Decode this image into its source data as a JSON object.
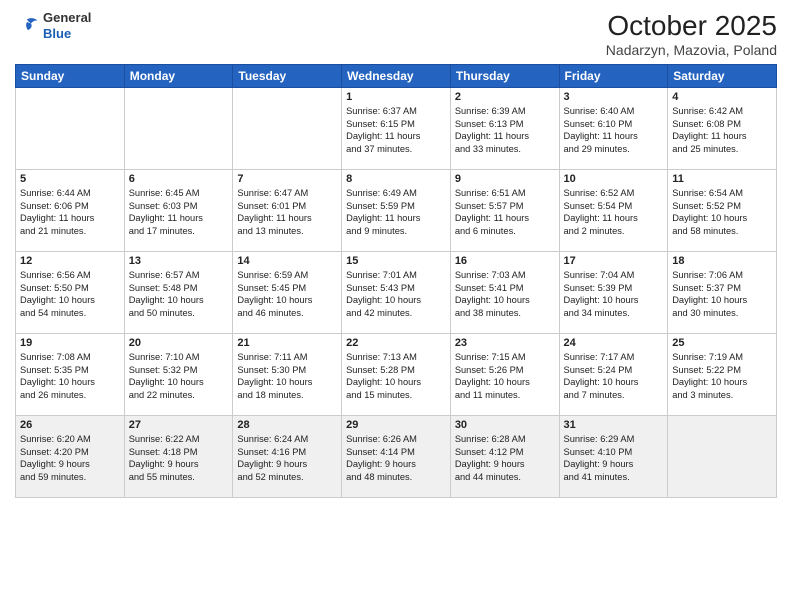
{
  "header": {
    "logo_general": "General",
    "logo_blue": "Blue",
    "month": "October 2025",
    "location": "Nadarzyn, Mazovia, Poland"
  },
  "days_of_week": [
    "Sunday",
    "Monday",
    "Tuesday",
    "Wednesday",
    "Thursday",
    "Friday",
    "Saturday"
  ],
  "weeks": [
    [
      {
        "day": "",
        "info": ""
      },
      {
        "day": "",
        "info": ""
      },
      {
        "day": "",
        "info": ""
      },
      {
        "day": "1",
        "info": "Sunrise: 6:37 AM\nSunset: 6:15 PM\nDaylight: 11 hours\nand 37 minutes."
      },
      {
        "day": "2",
        "info": "Sunrise: 6:39 AM\nSunset: 6:13 PM\nDaylight: 11 hours\nand 33 minutes."
      },
      {
        "day": "3",
        "info": "Sunrise: 6:40 AM\nSunset: 6:10 PM\nDaylight: 11 hours\nand 29 minutes."
      },
      {
        "day": "4",
        "info": "Sunrise: 6:42 AM\nSunset: 6:08 PM\nDaylight: 11 hours\nand 25 minutes."
      }
    ],
    [
      {
        "day": "5",
        "info": "Sunrise: 6:44 AM\nSunset: 6:06 PM\nDaylight: 11 hours\nand 21 minutes."
      },
      {
        "day": "6",
        "info": "Sunrise: 6:45 AM\nSunset: 6:03 PM\nDaylight: 11 hours\nand 17 minutes."
      },
      {
        "day": "7",
        "info": "Sunrise: 6:47 AM\nSunset: 6:01 PM\nDaylight: 11 hours\nand 13 minutes."
      },
      {
        "day": "8",
        "info": "Sunrise: 6:49 AM\nSunset: 5:59 PM\nDaylight: 11 hours\nand 9 minutes."
      },
      {
        "day": "9",
        "info": "Sunrise: 6:51 AM\nSunset: 5:57 PM\nDaylight: 11 hours\nand 6 minutes."
      },
      {
        "day": "10",
        "info": "Sunrise: 6:52 AM\nSunset: 5:54 PM\nDaylight: 11 hours\nand 2 minutes."
      },
      {
        "day": "11",
        "info": "Sunrise: 6:54 AM\nSunset: 5:52 PM\nDaylight: 10 hours\nand 58 minutes."
      }
    ],
    [
      {
        "day": "12",
        "info": "Sunrise: 6:56 AM\nSunset: 5:50 PM\nDaylight: 10 hours\nand 54 minutes."
      },
      {
        "day": "13",
        "info": "Sunrise: 6:57 AM\nSunset: 5:48 PM\nDaylight: 10 hours\nand 50 minutes."
      },
      {
        "day": "14",
        "info": "Sunrise: 6:59 AM\nSunset: 5:45 PM\nDaylight: 10 hours\nand 46 minutes."
      },
      {
        "day": "15",
        "info": "Sunrise: 7:01 AM\nSunset: 5:43 PM\nDaylight: 10 hours\nand 42 minutes."
      },
      {
        "day": "16",
        "info": "Sunrise: 7:03 AM\nSunset: 5:41 PM\nDaylight: 10 hours\nand 38 minutes."
      },
      {
        "day": "17",
        "info": "Sunrise: 7:04 AM\nSunset: 5:39 PM\nDaylight: 10 hours\nand 34 minutes."
      },
      {
        "day": "18",
        "info": "Sunrise: 7:06 AM\nSunset: 5:37 PM\nDaylight: 10 hours\nand 30 minutes."
      }
    ],
    [
      {
        "day": "19",
        "info": "Sunrise: 7:08 AM\nSunset: 5:35 PM\nDaylight: 10 hours\nand 26 minutes."
      },
      {
        "day": "20",
        "info": "Sunrise: 7:10 AM\nSunset: 5:32 PM\nDaylight: 10 hours\nand 22 minutes."
      },
      {
        "day": "21",
        "info": "Sunrise: 7:11 AM\nSunset: 5:30 PM\nDaylight: 10 hours\nand 18 minutes."
      },
      {
        "day": "22",
        "info": "Sunrise: 7:13 AM\nSunset: 5:28 PM\nDaylight: 10 hours\nand 15 minutes."
      },
      {
        "day": "23",
        "info": "Sunrise: 7:15 AM\nSunset: 5:26 PM\nDaylight: 10 hours\nand 11 minutes."
      },
      {
        "day": "24",
        "info": "Sunrise: 7:17 AM\nSunset: 5:24 PM\nDaylight: 10 hours\nand 7 minutes."
      },
      {
        "day": "25",
        "info": "Sunrise: 7:19 AM\nSunset: 5:22 PM\nDaylight: 10 hours\nand 3 minutes."
      }
    ],
    [
      {
        "day": "26",
        "info": "Sunrise: 6:20 AM\nSunset: 4:20 PM\nDaylight: 9 hours\nand 59 minutes."
      },
      {
        "day": "27",
        "info": "Sunrise: 6:22 AM\nSunset: 4:18 PM\nDaylight: 9 hours\nand 55 minutes."
      },
      {
        "day": "28",
        "info": "Sunrise: 6:24 AM\nSunset: 4:16 PM\nDaylight: 9 hours\nand 52 minutes."
      },
      {
        "day": "29",
        "info": "Sunrise: 6:26 AM\nSunset: 4:14 PM\nDaylight: 9 hours\nand 48 minutes."
      },
      {
        "day": "30",
        "info": "Sunrise: 6:28 AM\nSunset: 4:12 PM\nDaylight: 9 hours\nand 44 minutes."
      },
      {
        "day": "31",
        "info": "Sunrise: 6:29 AM\nSunset: 4:10 PM\nDaylight: 9 hours\nand 41 minutes."
      },
      {
        "day": "",
        "info": ""
      }
    ]
  ]
}
